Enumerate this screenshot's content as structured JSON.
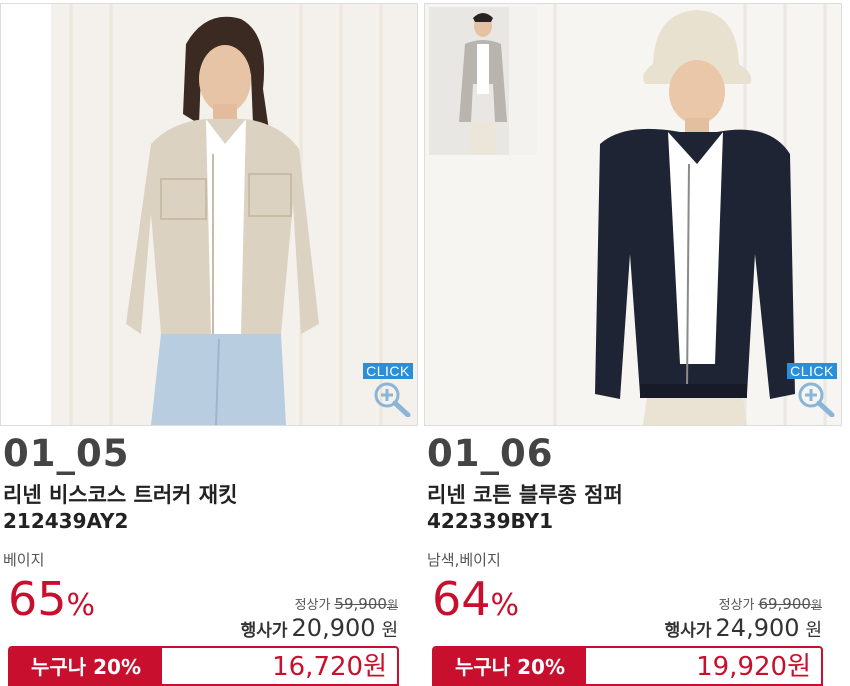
{
  "products": [
    {
      "code": "01_05",
      "name": "리넨 비스코스 트러커 재킷",
      "sku": "212439AY2",
      "color_options": "베이지",
      "discount_number": "65",
      "discount_unit": "%",
      "regular_label": "정상가",
      "regular_price": "59,900",
      "regular_unit": "원",
      "event_label": "행사가",
      "event_price": "20,900",
      "event_unit": "원",
      "promo_label": "누구나 20%",
      "promo_price": "16,720원",
      "click_label": "CLICK"
    },
    {
      "code": "01_06",
      "name": "리넨 코튼 블루종 점퍼",
      "sku": "422339BY1",
      "color_options": "남색,베이지",
      "discount_number": "64",
      "discount_unit": "%",
      "regular_label": "정상가",
      "regular_price": "69,900",
      "regular_unit": "원",
      "event_label": "행사가",
      "event_price": "24,900",
      "event_unit": "원",
      "promo_label": "누구나 20%",
      "promo_price": "19,920원",
      "click_label": "CLICK"
    }
  ],
  "colors": {
    "accent": "#c8102e",
    "click_badge": "#2a8fd6"
  },
  "icons": {
    "zoom": "zoom-in-icon"
  }
}
